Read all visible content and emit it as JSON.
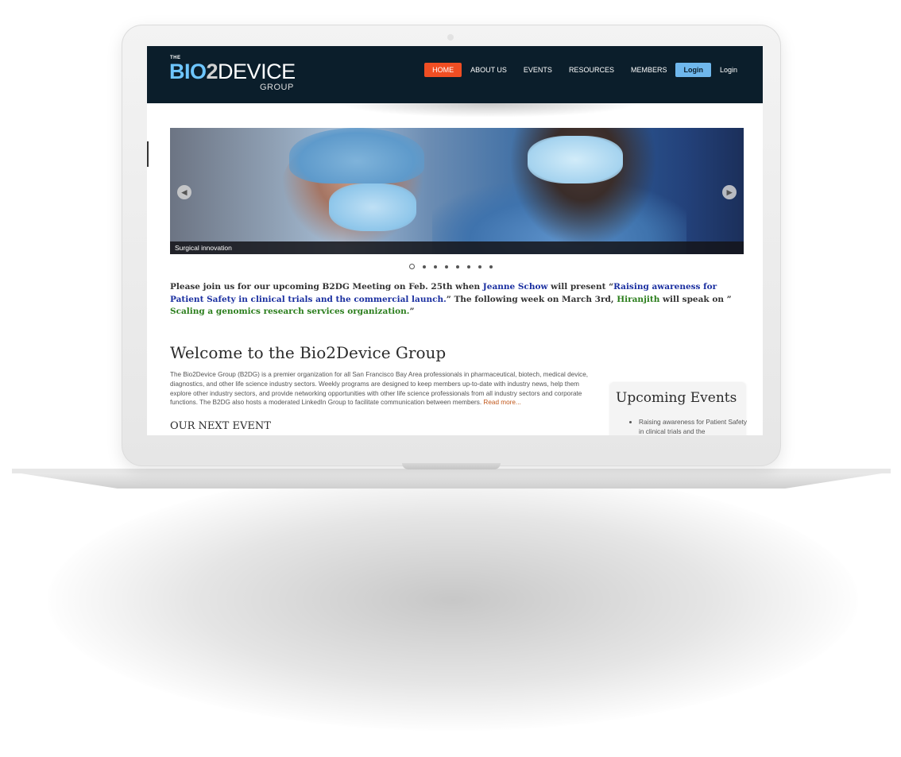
{
  "site": {
    "logo": {
      "the": "THE",
      "bio": "BIO",
      "two": "2",
      "device": "DEVICE",
      "group": "GROUP"
    },
    "nav": [
      {
        "label": "HOME",
        "active": true
      },
      {
        "label": "ABOUT US"
      },
      {
        "label": "EVENTS"
      },
      {
        "label": "RESOURCES"
      },
      {
        "label": "MEMBERS"
      },
      {
        "label": "Login",
        "style": "button"
      },
      {
        "label": "Login"
      }
    ]
  },
  "slider": {
    "caption": "Surgical innovation",
    "prev_icon": "arrow-left-icon",
    "next_icon": "arrow-right-icon",
    "prev_glyph": "◂",
    "next_glyph": "▸",
    "dot_count": 8,
    "active_dot": 0
  },
  "announcement": {
    "p1": "Please join us for our upcoming B2DG Meeting on Feb. 25th when ",
    "speaker1": "Jeanne Schow",
    "p2": " will present “",
    "talk1": "Raising awareness for Patient Safety in clinical trials and the commercial launch.",
    "p3": "”  The following week on March 3rd,  ",
    "speaker2": "Hiranjith",
    "p4": " will speak on ” ",
    "talk2": "Scaling a genomics research services organization.",
    "p5": "”"
  },
  "welcome": {
    "title": "Welcome to the Bio2Device Group",
    "body": "The Bio2Device Group (B2DG) is a premier organization for all San Francisco Bay Area professionals in pharmaceutical, biotech, medical device, diagnostics, and other life science industry sectors. Weekly programs are designed to keep members up-to-date with industry news, help them explore other industry sectors, and provide networking opportunities with other life science professionals from all industry sectors and corporate functions. The B2DG also hosts a moderated LinkedIn Group to facilitate communication between members. ",
    "read_more": "Read more..."
  },
  "next_event": {
    "title": "OUR NEXT EVENT"
  },
  "upcoming": {
    "title": "Upcoming Events",
    "items": [
      "Raising awareness for Patient Safety in clinical trials and the"
    ]
  },
  "colors": {
    "header_bg": "#0b1e2b",
    "nav_active": "#f04e23",
    "login_button": "#6fb7ec",
    "link_blue": "#1a2fa0",
    "link_green": "#2a7d1b",
    "read_more": "#c0571b"
  }
}
